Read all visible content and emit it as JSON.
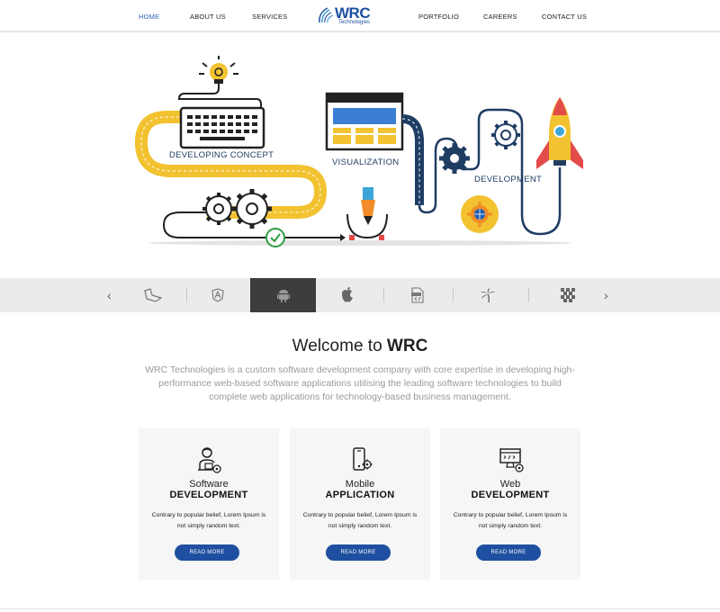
{
  "nav": {
    "items": [
      "HOME",
      "ABOUT US",
      "SERVICES",
      "PORTFOLIO",
      "CAREERS",
      "CONTACT US"
    ],
    "active": "HOME"
  },
  "logo": {
    "name": "WRC",
    "sub": "Technologies"
  },
  "hero": {
    "labels": [
      "DEVELOPING CONCEPT",
      "VISUALIZATION",
      "DEVELOPMENT"
    ]
  },
  "techbar": {
    "icons": [
      "laravel-icon",
      "angular-icon",
      "android-icon",
      "apple-icon",
      "php-icon",
      "palm-icon",
      "pixel-icon"
    ],
    "active": "android-icon"
  },
  "welcome": {
    "title_prefix": "Welcome to ",
    "title_brand": "WRC",
    "intro": "WRC Technologies is a custom software development company with core expertise in developing high-performance web-based software applications utilising the leading software technologies to build complete web applications for technology-based business management."
  },
  "cards": [
    {
      "title_line1": "Software",
      "title_line2": "DEVELOPMENT",
      "desc": "Contrary to popular belief, Lorem Ipsum is not simply random text.",
      "button": "READ MORE",
      "icon": "developer-icon"
    },
    {
      "title_line1": "Mobile",
      "title_line2": "APPLICATION",
      "desc": "Contrary to popular belief, Lorem Ipsum is not simply random text.",
      "button": "READ MORE",
      "icon": "mobile-settings-icon"
    },
    {
      "title_line1": "Web",
      "title_line2": "DEVELOPMENT",
      "desc": "Contrary to popular belief, Lorem Ipsum is not simply random text.",
      "button": "READ MORE",
      "icon": "web-code-icon"
    }
  ],
  "colors": {
    "accent": "#1f4fa0",
    "nav_active": "#2b5fb3",
    "road_yellow": "#f2c230",
    "road_navy": "#1f3d63"
  }
}
